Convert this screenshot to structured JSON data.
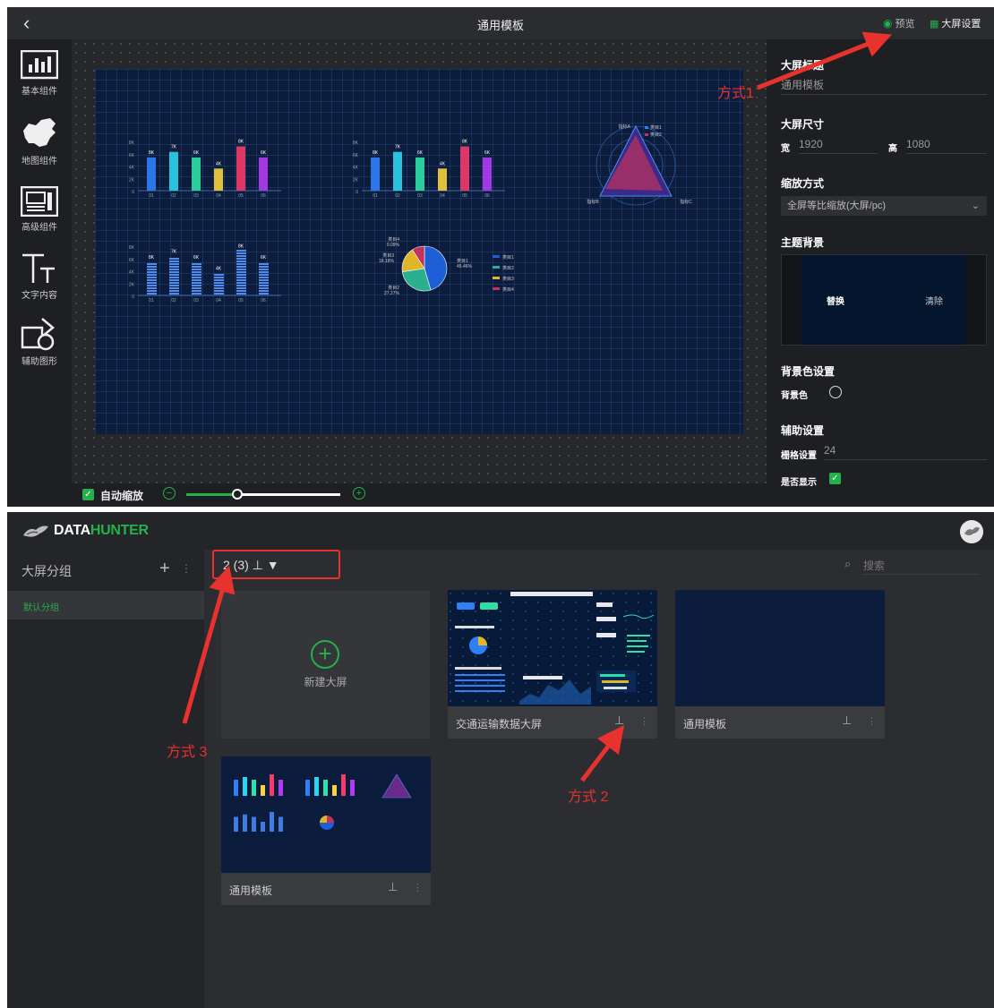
{
  "editor": {
    "title": "通用模板",
    "back": "‹",
    "preview_label": "预览",
    "screen_settings_label": "大屏设置",
    "rail": [
      {
        "label": "基本组件"
      },
      {
        "label": "地图组件"
      },
      {
        "label": "高级组件"
      },
      {
        "label": "文字内容"
      },
      {
        "label": "辅助图形"
      }
    ],
    "zoom": {
      "auto_label": "自动缩放",
      "check": "✓",
      "minus": "−",
      "plus": "+",
      "level": 0.33
    },
    "panel": {
      "title_section": "大屏标题",
      "title_value": "通用模板",
      "size_section": "大屏尺寸",
      "width_label": "宽",
      "width_value": "1920",
      "height_label": "高",
      "height_value": "1080",
      "scale_section": "缩放方式",
      "scale_value": "全屏等比缩放(大屏/pc)",
      "scale_chev": "⌄",
      "theme_section": "主题背景",
      "replace": "替换",
      "clear": "清除",
      "bg_section": "背景色设置",
      "bg_label": "背景色",
      "aux_section": "辅助设置",
      "grid_label": "栅格设置",
      "grid_value": "24",
      "show_label": "是否显示",
      "check": "✓"
    }
  },
  "mini_charts": {
    "bar_labels": [
      "8K",
      "7K",
      "6K",
      "4K",
      "8K",
      "6K"
    ],
    "categories": [
      "01",
      "02",
      "03",
      "04",
      "05",
      "06"
    ],
    "y_ticks": [
      "8K",
      "6K",
      "4K",
      "2K",
      "0"
    ],
    "values": [
      6,
      7,
      6,
      4,
      8,
      6
    ],
    "bar_colors": [
      "#2f7ff7",
      "#2bd4f0",
      "#2ee0a6",
      "#f5d33a",
      "#f23c6a",
      "#b23cf5"
    ],
    "radar_labels": [
      "指标A",
      "指标B",
      "指标C"
    ],
    "radar_legend": [
      "类目1",
      "类目2"
    ],
    "pie": {
      "labels": [
        "类目4\n9.09%",
        "类目3\n18.18%",
        "类目1\n45.46%",
        "类目2\n27.27%"
      ],
      "legend": [
        "类目1",
        "类目2",
        "类目3",
        "类目4"
      ],
      "values": [
        45.46,
        27.27,
        18.18,
        9.09
      ],
      "colors": [
        "#1f5fd6",
        "#2bb08f",
        "#e0b52a",
        "#c2325c"
      ]
    }
  },
  "datahunter": {
    "logo_a": "DATA",
    "logo_b": "HUNTER",
    "sidebar_title": "大屏分组",
    "add": "+",
    "more": "⋮",
    "default_group": "默认分组",
    "filter": "2 (3) ⊥ ▼",
    "search_placeholder": "搜索",
    "search_icon": "⌕",
    "new_label": "新建大屏",
    "new_plus": "+",
    "cards": [
      {
        "name": "交通运输数据大屏"
      },
      {
        "name": "通用模板"
      },
      {
        "name": "通用模板"
      }
    ],
    "present_icon": "⊥"
  },
  "annotations": {
    "a1": "方式1",
    "a2": "方式 2",
    "a3": "方式 3"
  },
  "colors": {
    "accent": "#25b04b",
    "annot": "#e8322e",
    "screen_bg": "#0b1c3d"
  }
}
